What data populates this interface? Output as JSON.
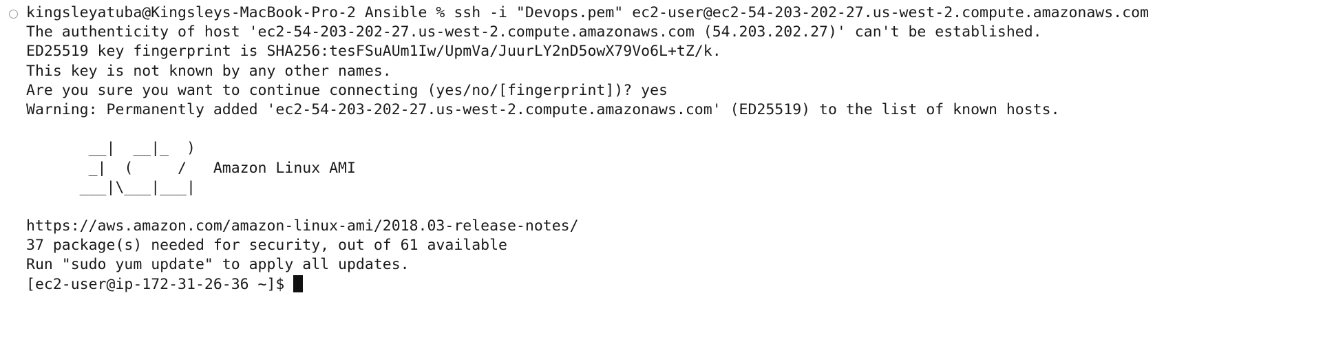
{
  "terminal": {
    "lines": [
      "kingsleyatuba@Kingsleys-MacBook-Pro-2 Ansible % ssh -i \"Devops.pem\" ec2-user@ec2-54-203-202-27.us-west-2.compute.amazonaws.com",
      "The authenticity of host 'ec2-54-203-202-27.us-west-2.compute.amazonaws.com (54.203.202.27)' can't be established.",
      "ED25519 key fingerprint is SHA256:tesFSuAUm1Iw/UpmVa/JuurLY2nD5owX79Vo6L+tZ/k.",
      "This key is not known by any other names.",
      "Are you sure you want to continue connecting (yes/no/[fingerprint])? yes",
      "Warning: Permanently added 'ec2-54-203-202-27.us-west-2.compute.amazonaws.com' (ED25519) to the list of known hosts.",
      "",
      "       __|  __|_  )",
      "       _|  (     /   Amazon Linux AMI",
      "      ___|\\___|___|",
      "",
      "https://aws.amazon.com/amazon-linux-ami/2018.03-release-notes/",
      "37 package(s) needed for security, out of 61 available",
      "Run \"sudo yum update\" to apply all updates."
    ],
    "prompt": "[ec2-user@ip-172-31-26-36 ~]$ "
  },
  "colors": {
    "background": "#ffffff",
    "text": "#1a1a1a",
    "cursor": "#111111"
  }
}
